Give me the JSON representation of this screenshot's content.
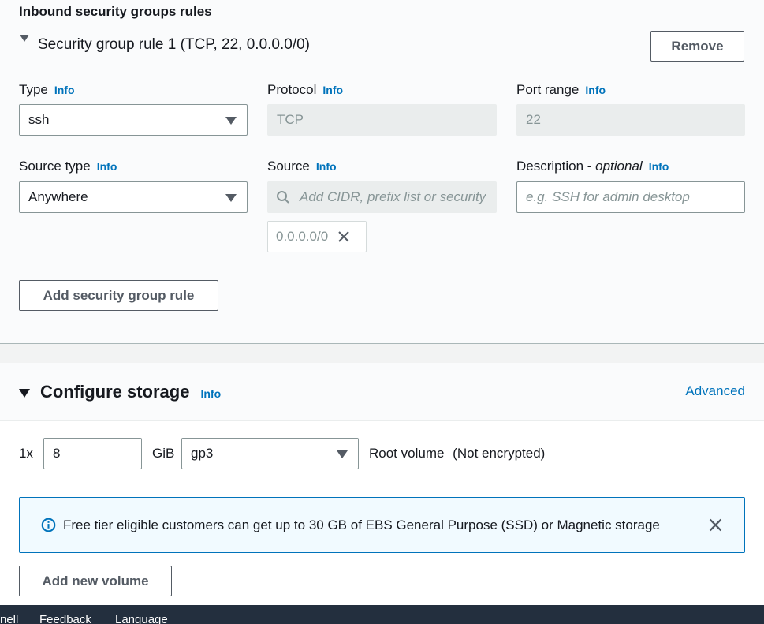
{
  "inbound": {
    "heading": "Inbound security groups rules",
    "rule_title": "Security group rule 1 (TCP, 22, 0.0.0.0/0)",
    "remove_label": "Remove",
    "info": "Info",
    "type_label": "Type",
    "type_value": "ssh",
    "protocol_label": "Protocol",
    "protocol_value": "TCP",
    "port_label": "Port range",
    "port_value": "22",
    "source_type_label": "Source type",
    "source_type_value": "Anywhere",
    "source_label": "Source",
    "source_placeholder": "Add CIDR, prefix list or security",
    "source_token": "0.0.0.0/0",
    "description_label": "Description - ",
    "description_optional": "optional",
    "description_placeholder": "e.g. SSH for admin desktop",
    "add_rule_label": "Add security group rule"
  },
  "storage": {
    "heading": "Configure storage",
    "info": "Info",
    "advanced_label": "Advanced",
    "count_label": "1x",
    "size_value": "8",
    "unit_label": "GiB",
    "volume_type": "gp3",
    "root_label": "Root volume",
    "encryption_label": "(Not encrypted)",
    "alert_text": "Free tier eligible customers can get up to 30 GB of EBS General Purpose (SSD) or Magnetic storage",
    "add_volume_label": "Add new volume"
  },
  "footer": {
    "items": [
      "nell",
      "Feedback",
      "Language"
    ]
  },
  "colors": {
    "link": "#0073bb",
    "footer_bg": "#232f3e",
    "alert_border": "#0073bb",
    "alert_bg": "#f1faff"
  }
}
